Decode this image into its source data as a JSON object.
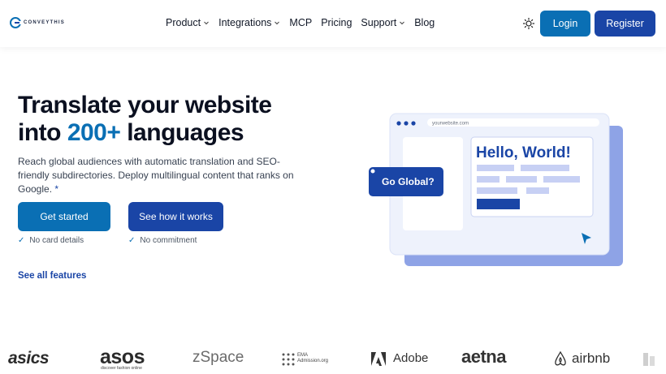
{
  "brand": {
    "logo_text": "CONVEYTHIS",
    "logo_icon": "conveythis-logo-icon"
  },
  "nav": {
    "items": [
      {
        "label": "Product",
        "has_dropdown": true
      },
      {
        "label": "Integrations",
        "has_dropdown": true
      },
      {
        "label": "MCP",
        "has_dropdown": false
      },
      {
        "label": "Pricing",
        "has_dropdown": false
      },
      {
        "label": "Support",
        "has_dropdown": true
      },
      {
        "label": "Blog",
        "has_dropdown": false
      }
    ],
    "theme_icon": "sun-icon",
    "login_label": "Login",
    "register_label": "Register"
  },
  "hero": {
    "title_line1": "Translate your website",
    "title_line2_prefix": "into ",
    "title_line2_accent": "200+",
    "title_line2_suffix": " languages",
    "subtitle": "Reach global audiences with automatic translation and SEO-friendly subdirectories. Deploy multilingual content that ranks on Google.",
    "subtitle_star": "*",
    "primary_cta": "Get started",
    "secondary_cta": "See how it works",
    "note_1": "No card details",
    "note_2": "No commitment",
    "check_glyph": "✓",
    "see_all": "See all features"
  },
  "illustration": {
    "url_text": "yourwebsite.com",
    "heading": "Hello, World!",
    "badge": "Go Global?"
  },
  "logos": {
    "asics": "asics",
    "asos": "asos",
    "asos_tagline": "discover fashion online",
    "zspace": "zSpace",
    "ema_line1": "EMA",
    "ema_line2": "Admission.org",
    "adobe": "Adobe",
    "aetna": "aetna",
    "airbnb": "airbnb"
  },
  "colors": {
    "primary": "#0a6fb4",
    "secondary": "#1a45a6",
    "accent_text": "#0a6fb4"
  }
}
